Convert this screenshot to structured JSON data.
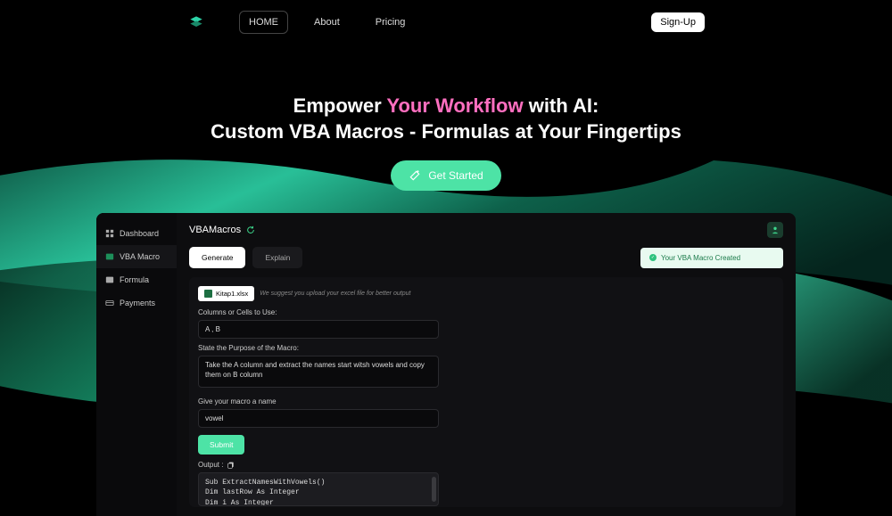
{
  "nav": {
    "links": [
      "HOME",
      "About",
      "Pricing"
    ],
    "signup": "Sign-Up"
  },
  "hero": {
    "line1_a": "Empower ",
    "line1_highlight": "Your Workflow",
    "line1_b": " with AI:",
    "line2": "Custom VBA Macros - Formulas at Your Fingertips",
    "cta": "Get Started"
  },
  "sidebar": {
    "items": [
      {
        "label": "Dashboard"
      },
      {
        "label": "VBA Macro"
      },
      {
        "label": "Formula"
      },
      {
        "label": "Payments"
      }
    ]
  },
  "main": {
    "title": "VBAMacros",
    "tabs": {
      "generate": "Generate",
      "explain": "Explain"
    },
    "toast": "Your VBA Macro Created",
    "file_chip": "Kitap1.xlsx",
    "hint": "We suggest you upload your excel file for better output",
    "label_columns": "Columns or Cells to Use:",
    "value_columns": "A , B",
    "label_purpose": "State the Purpose of the Macro:",
    "value_purpose": "Take the A column and extract the names start witsh vowels and copy them on B column",
    "label_name": "Give your macro a name",
    "value_name": "vowel",
    "submit": "Submit",
    "output_label": "Output :",
    "output_lines": [
      "Sub ExtractNamesWithVowels()",
      "    Dim lastRow As Integer",
      "    Dim i As Integer"
    ]
  }
}
